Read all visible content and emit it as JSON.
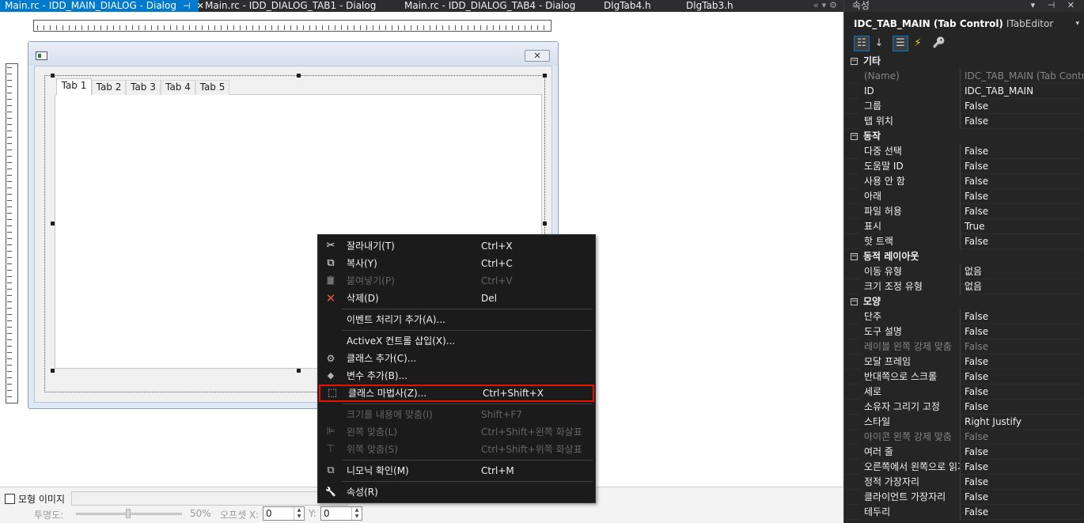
{
  "doc_tabs": [
    {
      "label": "Main.rc - IDD_MAIN_DIALOG - Dialog",
      "active": true,
      "pin": "⊣",
      "close": "✕"
    },
    {
      "label": "Main.rc - IDD_DIALOG_TAB1 - Dialog",
      "active": false
    },
    {
      "label": "Main.rc - IDD_DIALOG_TAB4 - Dialog",
      "active": false
    },
    {
      "label": "DlgTab4.h",
      "active": false
    },
    {
      "label": "DlgTab3.h",
      "active": false
    }
  ],
  "tabbar_tools": "«▾⚙",
  "dialog": {
    "close_glyph": "✕",
    "tabs": [
      "Tab 1",
      "Tab 2",
      "Tab 3",
      "Tab 4",
      "Tab 5"
    ]
  },
  "bottom": {
    "checkbox_label": "모형 이미지",
    "opacity_label": "투명도:",
    "opacity_value": "50%",
    "offset_label": "오프셋 X:",
    "offset_x": "0",
    "y_label": "Y:",
    "offset_y": "0"
  },
  "context_menu": {
    "items": [
      {
        "icon": "cut-icon",
        "glyph": "✂",
        "label": "잘라내기(T)",
        "shortcut": "Ctrl+X",
        "disabled": false
      },
      {
        "icon": "copy-icon",
        "glyph": "⧉",
        "label": "복사(Y)",
        "shortcut": "Ctrl+C",
        "disabled": false
      },
      {
        "icon": "paste-icon",
        "glyph": "📋",
        "label": "붙여넣기(P)",
        "shortcut": "Ctrl+V",
        "disabled": true
      },
      {
        "icon": "delete-icon",
        "glyph": "✕",
        "label": "삭제(D)",
        "shortcut": "Del",
        "disabled": false
      },
      {
        "icon": "",
        "glyph": "",
        "label": "이벤트 처리기 추가(A)...",
        "shortcut": "",
        "disabled": false
      },
      {
        "icon": "",
        "glyph": "",
        "label": "ActiveX 컨트롤 삽입(X)...",
        "shortcut": "",
        "disabled": false
      },
      {
        "icon": "add-class-icon",
        "glyph": "⚙",
        "label": "클래스 추가(C)...",
        "shortcut": "",
        "disabled": false
      },
      {
        "icon": "add-variable-icon",
        "glyph": "◆",
        "label": "변수 추가(B)...",
        "shortcut": "",
        "disabled": false
      },
      {
        "icon": "class-wizard-icon",
        "glyph": "⬚",
        "label": "클래스 마법사(Z)...",
        "shortcut": "Ctrl+Shift+X",
        "disabled": false,
        "highlighted": true
      },
      {
        "icon": "",
        "glyph": "",
        "label": "크기를 내용에 맞춤(I)",
        "shortcut": "Shift+F7",
        "disabled": true
      },
      {
        "icon": "align-left-icon",
        "glyph": "⊫",
        "label": "왼쪽 맞춤(L)",
        "shortcut": "Ctrl+Shift+왼쪽 화살표",
        "disabled": true
      },
      {
        "icon": "align-top-icon",
        "glyph": "⊤",
        "label": "위쪽 맞춤(S)",
        "shortcut": "Ctrl+Shift+위쪽 화살표",
        "disabled": true
      },
      {
        "icon": "mnemonic-icon",
        "glyph": "⧉",
        "label": "니모닉 확인(M)",
        "shortcut": "Ctrl+M",
        "disabled": false
      },
      {
        "icon": "properties-wrench-icon",
        "glyph": "🔧",
        "label": "속성(R)",
        "shortcut": "",
        "disabled": false
      }
    ]
  },
  "properties": {
    "title": "속성",
    "title_tools": "▾ ⊣ ✕",
    "object_name": "IDC_TAB_MAIN (Tab Control)",
    "object_type": "ITabEditor",
    "dropdown_glyph": "▾",
    "toolbar": [
      {
        "icon": "categorized-icon",
        "glyph": "☷",
        "on": true
      },
      {
        "icon": "alphabetical-icon",
        "glyph": "↓",
        "on": false
      },
      {
        "icon": "properties-icon",
        "glyph": "☰",
        "on": true
      },
      {
        "icon": "events-icon",
        "glyph": "⚡",
        "on": false
      },
      {
        "icon": "property-pages-icon",
        "glyph": "🔑",
        "on": false
      }
    ],
    "categories": [
      {
        "name": "기타",
        "rows": [
          {
            "name": "(Name)",
            "value": "IDC_TAB_MAIN (Tab Control)",
            "readonly": true
          },
          {
            "name": "ID",
            "value": "IDC_TAB_MAIN"
          },
          {
            "name": "그룹",
            "value": "False"
          },
          {
            "name": "탭 위치",
            "value": "False"
          }
        ]
      },
      {
        "name": "동작",
        "rows": [
          {
            "name": "다중 선택",
            "value": "False"
          },
          {
            "name": "도움말 ID",
            "value": "False"
          },
          {
            "name": "사용 안 함",
            "value": "False"
          },
          {
            "name": "아래",
            "value": "False"
          },
          {
            "name": "파일 허용",
            "value": "False"
          },
          {
            "name": "표시",
            "value": "True"
          },
          {
            "name": "핫 트랙",
            "value": "False"
          }
        ]
      },
      {
        "name": "동적 레이아웃",
        "rows": [
          {
            "name": "이동 유형",
            "value": "없음"
          },
          {
            "name": "크기 조정 유형",
            "value": "없음"
          }
        ]
      },
      {
        "name": "모양",
        "rows": [
          {
            "name": "단추",
            "value": "False"
          },
          {
            "name": "도구 설명",
            "value": "False"
          },
          {
            "name": "레이블 왼쪽 강제 맞춤",
            "value": "False",
            "readonly": true
          },
          {
            "name": "모달 프레임",
            "value": "False"
          },
          {
            "name": "반대쪽으로 스크롤",
            "value": "False"
          },
          {
            "name": "세로",
            "value": "False"
          },
          {
            "name": "소유자 그리기 고정",
            "value": "False"
          },
          {
            "name": "스타일",
            "value": "Right Justify"
          },
          {
            "name": "아이콘 왼쪽 강제 맞춤",
            "value": "False",
            "readonly": true
          },
          {
            "name": "여러 줄",
            "value": "False"
          },
          {
            "name": "오른쪽에서 왼쪽으로 읽기",
            "value": "False"
          },
          {
            "name": "정적 가장자리",
            "value": "False"
          },
          {
            "name": "클라이언트 가장자리",
            "value": "False"
          },
          {
            "name": "테두리",
            "value": "False"
          }
        ]
      }
    ]
  }
}
